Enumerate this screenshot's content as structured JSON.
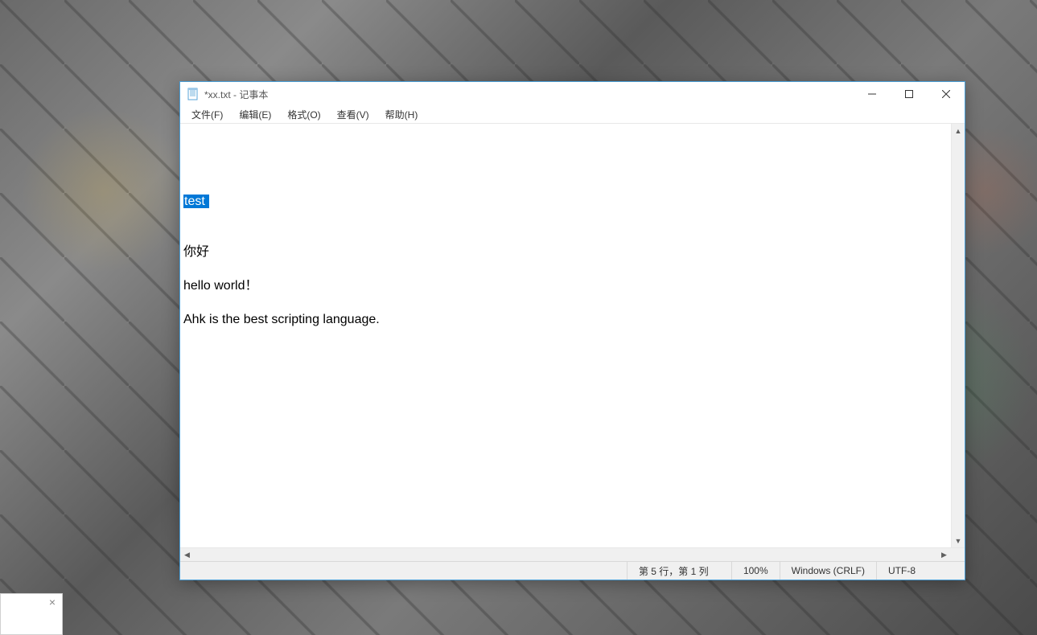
{
  "window": {
    "title": "*xx.txt - 记事本",
    "icon": "notepad-icon"
  },
  "menu": {
    "items": [
      {
        "label": "文件(F)"
      },
      {
        "label": "编辑(E)"
      },
      {
        "label": "格式(O)"
      },
      {
        "label": "查看(V)"
      },
      {
        "label": "帮助(H)"
      }
    ]
  },
  "editor": {
    "lines": [
      "",
      "",
      "",
      "",
      "test ",
      "",
      "",
      "你好",
      "",
      "hello world！",
      "",
      "Ahk is the best scripting language."
    ],
    "selection": {
      "line_index": 4,
      "text": "test "
    }
  },
  "statusbar": {
    "position": "第 5 行，第 1 列",
    "zoom": "100%",
    "line_ending": "Windows (CRLF)",
    "encoding": "UTF-8"
  },
  "desktop": {
    "small_popup_close": "×"
  }
}
